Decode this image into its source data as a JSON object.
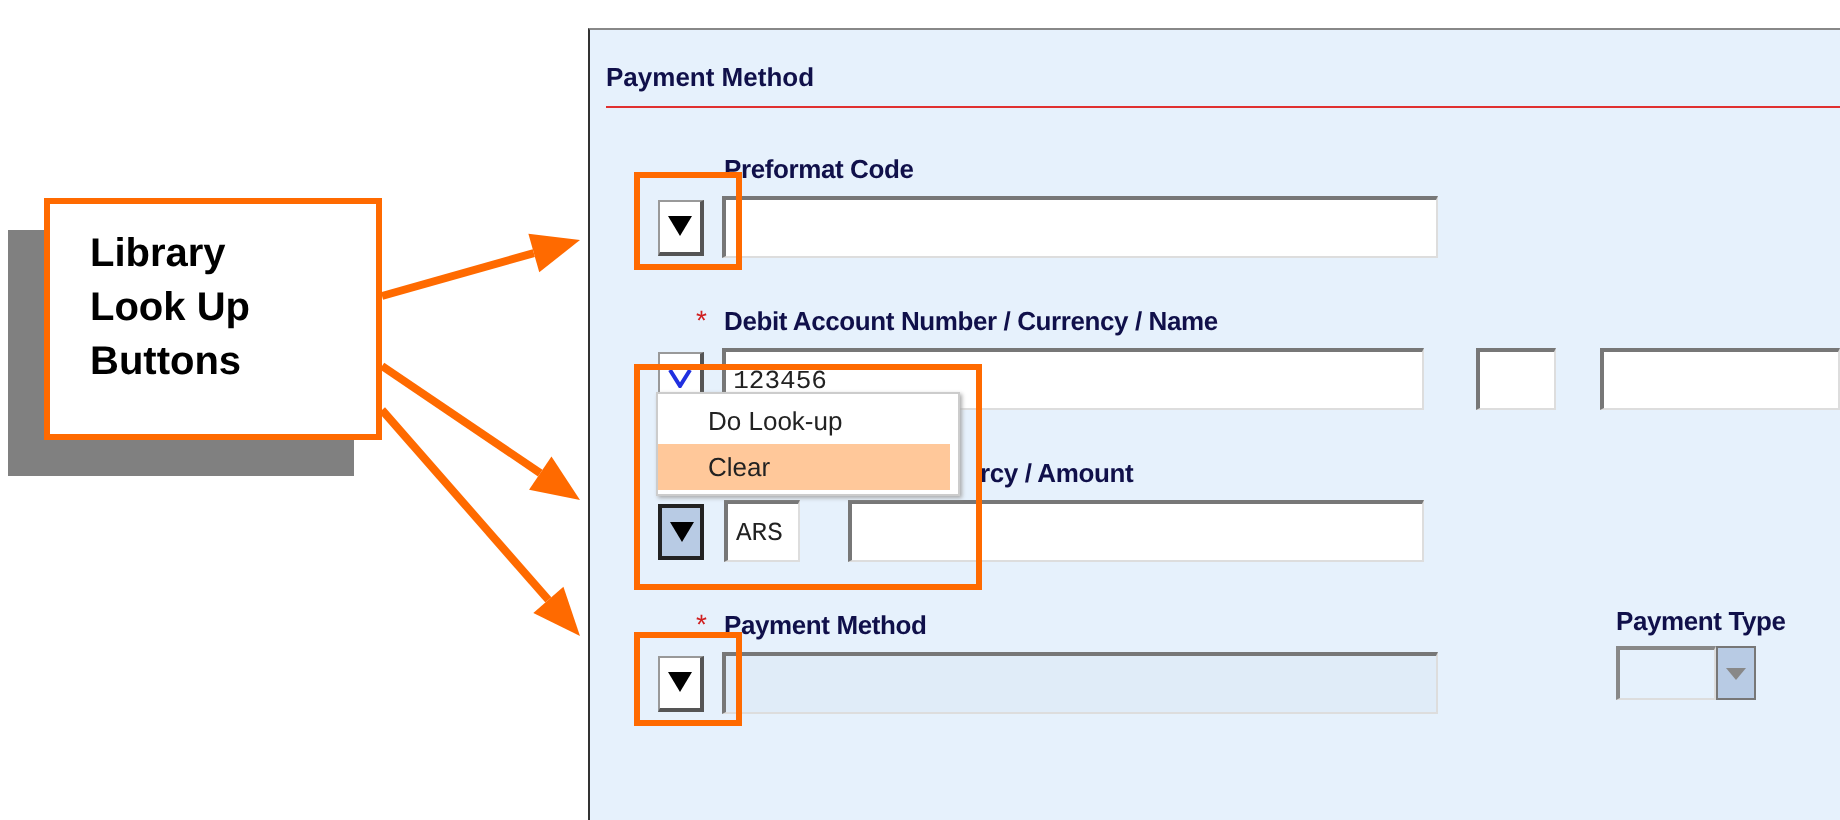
{
  "callout": {
    "text": "Library Look Up Buttons"
  },
  "form": {
    "title": "Payment Method",
    "rows": [
      {
        "label": "Preformat Code",
        "covered": false,
        "lookup": {
          "pressed": false,
          "focused": false
        },
        "inputs": [
          {
            "kind": "wide",
            "disabled": false
          }
        ]
      },
      {
        "mark": "*",
        "label": "Debit Account Number / Currency / Name",
        "covered": false,
        "lookup": {
          "pressed": false,
          "focused": true
        },
        "inputs": [
          {
            "kind": "wide",
            "value": "123456",
            "disabled": false
          },
          {
            "kind": "small",
            "disabled": false
          },
          {
            "kind": "tail",
            "disabled": false
          }
        ]
      },
      {
        "label": "rcy / Amount",
        "covered": true,
        "lookup": {
          "pressed": true,
          "focused": false
        },
        "inputs": [
          {
            "kind": "code",
            "value": "ARS",
            "disabled": false
          },
          {
            "kind": "amount",
            "disabled": false
          }
        ]
      },
      {
        "mark": "*",
        "label": "Payment Method",
        "covered": false,
        "lookup": {
          "pressed": false,
          "focused": false
        },
        "inputs": [
          {
            "kind": "wide",
            "disabled": true
          }
        ],
        "side": {
          "label": "Payment Type",
          "kind": "combo"
        }
      }
    ],
    "menu": [
      {
        "label": "Do Look-up",
        "selected": false
      },
      {
        "label": "Clear",
        "selected": true
      }
    ]
  }
}
